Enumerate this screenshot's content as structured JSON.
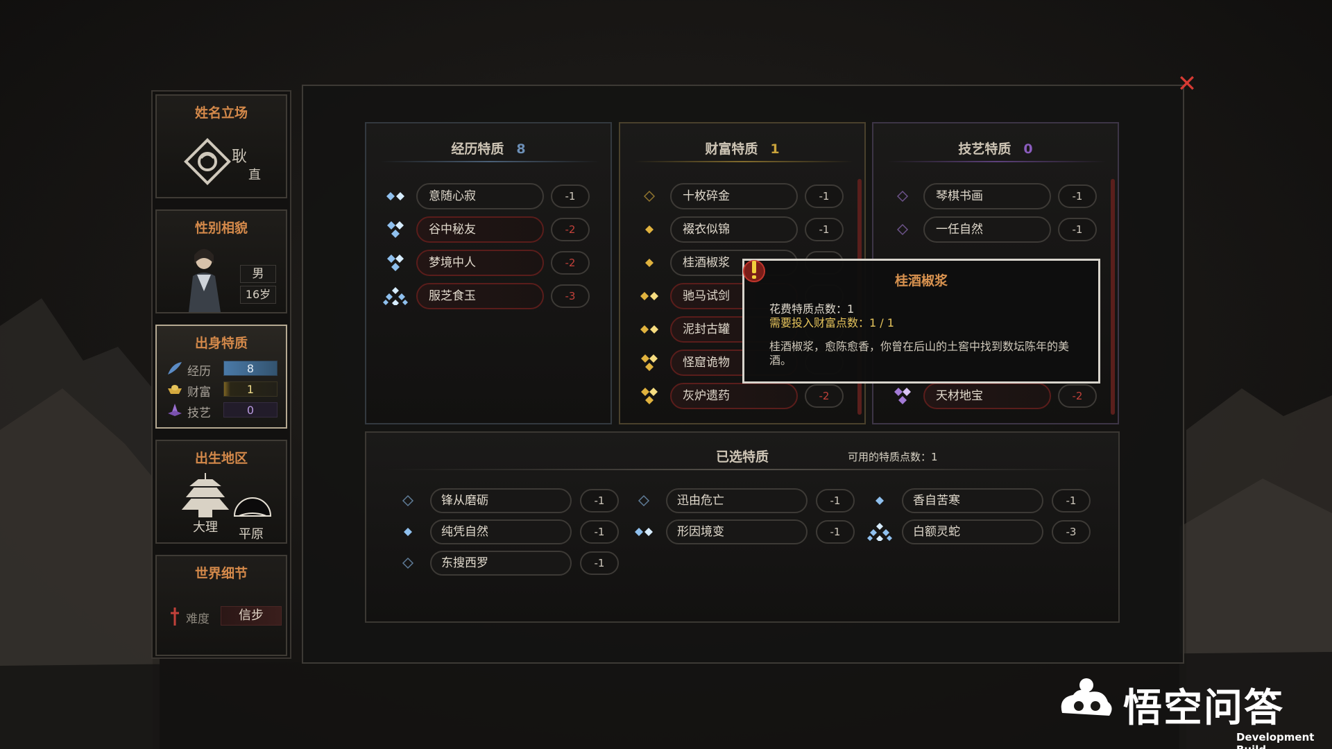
{
  "sidebar": {
    "name_card": {
      "title": "姓名立场",
      "surname": "耿",
      "stance": "直"
    },
    "gender_card": {
      "title": "性别相貌",
      "gender": "男",
      "age": "16岁"
    },
    "origin_card": {
      "title": "出身特质",
      "stats": [
        {
          "label": "经历",
          "value": "8",
          "color": "#4f86b8"
        },
        {
          "label": "财富",
          "value": "1",
          "color": "#c9a33b"
        },
        {
          "label": "技艺",
          "value": "0",
          "color": "#8a5cbd"
        }
      ]
    },
    "region_card": {
      "title": "出生地区",
      "city": "大理",
      "terrain": "平原"
    },
    "world_card": {
      "title": "世界细节",
      "difficulty_label": "难度",
      "difficulty_value": "信步"
    }
  },
  "columns": [
    {
      "title": "经历特质",
      "points": "8",
      "accent": "#6c8fb6",
      "traits": [
        {
          "name": "意随心寂",
          "cost": "-1",
          "gem": "blue",
          "gems": 2,
          "red": false
        },
        {
          "name": "谷中秘友",
          "cost": "-2",
          "gem": "blue",
          "gems": 3,
          "red": true
        },
        {
          "name": "梦境中人",
          "cost": "-2",
          "gem": "blue",
          "gems": 3,
          "red": true
        },
        {
          "name": "服芝食玉",
          "cost": "-3",
          "gem": "blue",
          "gems": 4,
          "red": true
        }
      ]
    },
    {
      "title": "财富特质",
      "points": "1",
      "accent": "#c9a33b",
      "traits": [
        {
          "name": "十枚碎金",
          "cost": "-1",
          "gem": "gold",
          "gems": 0,
          "red": false
        },
        {
          "name": "裰衣似锦",
          "cost": "-1",
          "gem": "gold",
          "gems": 1,
          "red": false
        },
        {
          "name": "桂酒椒浆",
          "cost": "",
          "gem": "gold",
          "gems": 1,
          "red": false
        },
        {
          "name": "驰马试剑",
          "cost": "",
          "gem": "gold",
          "gems": 2,
          "red": true
        },
        {
          "name": "泥封古罐",
          "cost": "",
          "gem": "gold",
          "gems": 2,
          "red": true
        },
        {
          "name": "怪窟诡物",
          "cost": "",
          "gem": "gold",
          "gems": 3,
          "red": true
        },
        {
          "name": "灰炉遗药",
          "cost": "-2",
          "gem": "gold",
          "gems": 3,
          "red": true
        }
      ]
    },
    {
      "title": "技艺特质",
      "points": "0",
      "accent": "#8a5cbd",
      "traits": [
        {
          "name": "琴棋书画",
          "cost": "-1",
          "gem": "purple",
          "gems": 0,
          "red": false
        },
        {
          "name": "一任自然",
          "cost": "-1",
          "gem": "purple",
          "gems": 0,
          "red": false
        },
        {
          "name": "天材地宝",
          "cost": "-2",
          "gem": "purple",
          "gems": 3,
          "red": true
        }
      ]
    }
  ],
  "tooltip": {
    "title": "桂酒椒浆",
    "cost_line": "花费特质点数：1",
    "need_line": "需要投入财富点数：1 / 1",
    "desc": "桂酒椒浆，愈陈愈香，你曾在后山的土窖中找到数坛陈年的美酒。"
  },
  "selected": {
    "title": "已选特质",
    "available": "可用的特质点数：1",
    "traits": [
      {
        "name": "锋从磨砺",
        "cost": "-1",
        "gems": 0
      },
      {
        "name": "纯凭自然",
        "cost": "-1",
        "gems": 1
      },
      {
        "name": "东搜西罗",
        "cost": "-1",
        "gems": 0
      },
      {
        "name": "迅由危亡",
        "cost": "-1",
        "gems": 0
      },
      {
        "name": "形因境变",
        "cost": "-1",
        "gems": 2
      },
      {
        "name": "香自苦寒",
        "cost": "-1",
        "gems": 1
      },
      {
        "name": "白额灵蛇",
        "cost": "-3",
        "gems": 4
      }
    ]
  },
  "watermark": "悟空问答",
  "dev_build": "Development Build",
  "close_icon": "close-icon"
}
